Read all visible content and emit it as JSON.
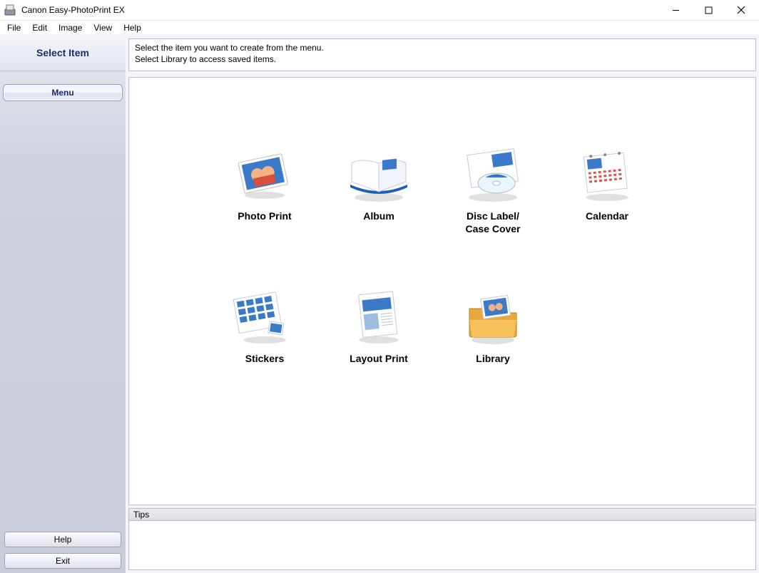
{
  "window": {
    "title": "Canon Easy-PhotoPrint EX"
  },
  "menubar": [
    "File",
    "Edit",
    "Image",
    "View",
    "Help"
  ],
  "sidebar": {
    "title": "Select Item",
    "menu_tab": "Menu",
    "help_btn": "Help",
    "exit_btn": "Exit"
  },
  "instructions": {
    "line1": "Select the item you want to create from the menu.",
    "line2": "Select Library to access saved items."
  },
  "items": [
    {
      "label": "Photo Print",
      "icon": "photo-print-icon"
    },
    {
      "label": "Album",
      "icon": "album-icon"
    },
    {
      "label": "Disc Label/\nCase Cover",
      "icon": "disc-label-icon"
    },
    {
      "label": "Calendar",
      "icon": "calendar-icon"
    },
    {
      "label": "Stickers",
      "icon": "stickers-icon"
    },
    {
      "label": "Layout Print",
      "icon": "layout-print-icon"
    },
    {
      "label": "Library",
      "icon": "library-icon"
    }
  ],
  "tips": {
    "header": "Tips"
  }
}
